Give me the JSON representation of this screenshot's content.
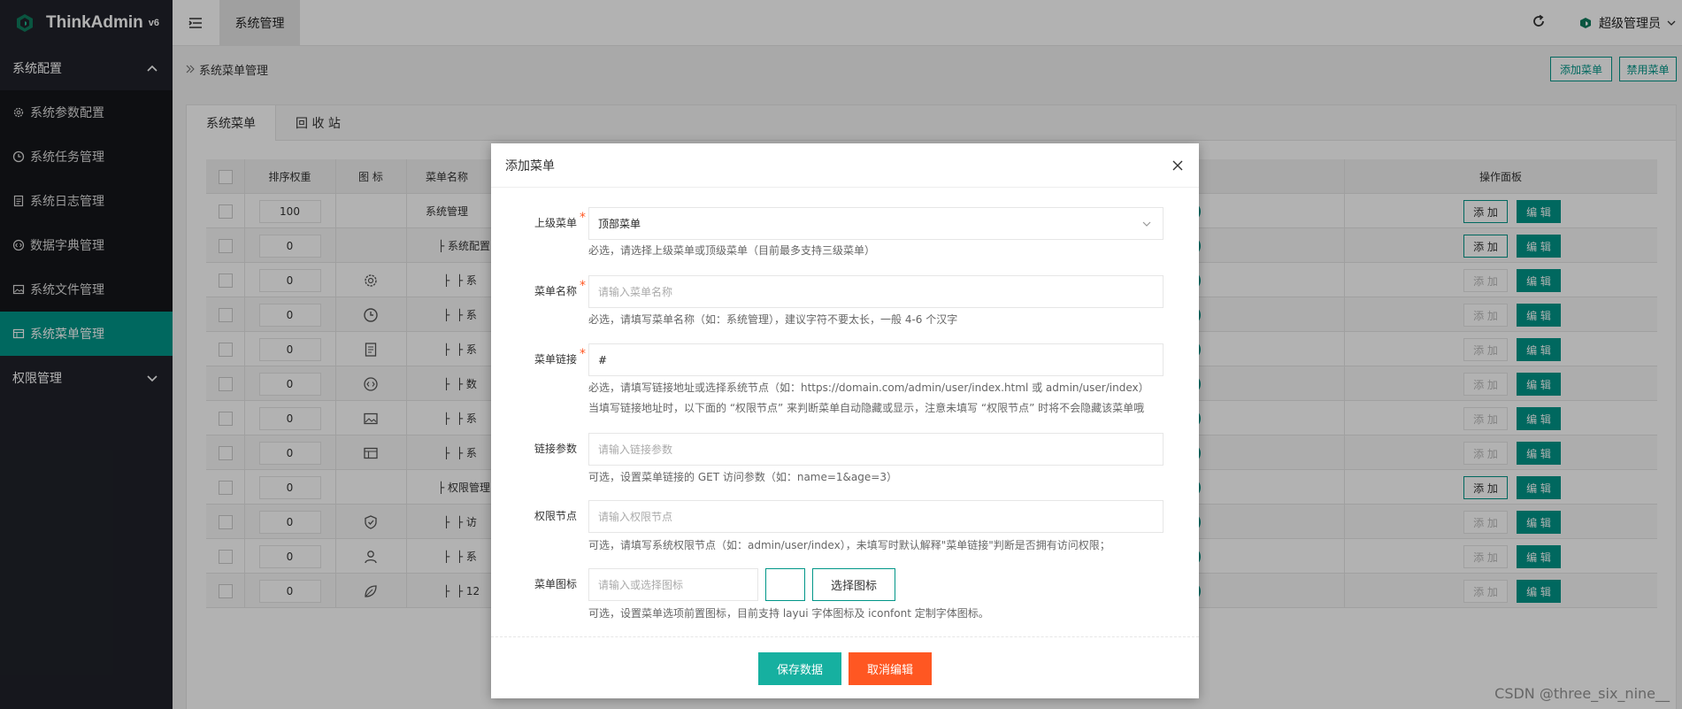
{
  "brand": {
    "name": "ThinkAdmin",
    "version": "v6"
  },
  "sidebar": {
    "group1": "系统配置",
    "items": [
      {
        "label": "系统参数配置",
        "icon": "gear-icon"
      },
      {
        "label": "系统任务管理",
        "icon": "clock-icon"
      },
      {
        "label": "系统日志管理",
        "icon": "log-icon"
      },
      {
        "label": "数据字典管理",
        "icon": "code-icon"
      },
      {
        "label": "系统文件管理",
        "icon": "image-icon"
      },
      {
        "label": "系统菜单管理",
        "icon": "menu-icon"
      }
    ],
    "group2": "权限管理"
  },
  "header": {
    "tab": "系统管理",
    "user": "超级管理员"
  },
  "breadcrumb": "系统菜单管理",
  "toolbar": {
    "add": "添加菜单",
    "disable": "禁用菜单"
  },
  "tabs": [
    "系统菜单",
    "回 收 站"
  ],
  "table": {
    "headers": {
      "weight": "排序权重",
      "icon": "图 标",
      "name": "菜单名称",
      "panel": "操作面板"
    },
    "rows": [
      {
        "weight": "100",
        "name": "系统管理",
        "icon": "",
        "add": "添 加",
        "edit": "编 辑"
      },
      {
        "weight": "0",
        "name": "├ 系统配置",
        "icon": "",
        "add": "添 加",
        "edit": "编 辑"
      },
      {
        "weight": "0",
        "name": "├  ├ 系",
        "icon": "gear-icon",
        "add": "添 加",
        "edit": "编 辑"
      },
      {
        "weight": "0",
        "name": "├  ├ 系",
        "icon": "clock-icon",
        "add": "添 加",
        "edit": "编 辑"
      },
      {
        "weight": "0",
        "name": "├  ├ 系",
        "icon": "log-icon",
        "add": "添 加",
        "edit": "编 辑"
      },
      {
        "weight": "0",
        "name": "├  ├ 数",
        "icon": "code-icon",
        "add": "添 加",
        "edit": "编 辑"
      },
      {
        "weight": "0",
        "name": "├  ├ 系",
        "icon": "image-icon",
        "add": "添 加",
        "edit": "编 辑"
      },
      {
        "weight": "0",
        "name": "├  ├ 系",
        "icon": "menu-icon",
        "add": "添 加",
        "edit": "编 辑"
      },
      {
        "weight": "0",
        "name": "├ 权限管理",
        "icon": "",
        "add": "添 加",
        "edit": "编 辑"
      },
      {
        "weight": "0",
        "name": "├  ├ 访",
        "icon": "shield-icon",
        "add": "添 加",
        "edit": "编 辑"
      },
      {
        "weight": "0",
        "name": "├  ├ 系",
        "icon": "user-icon",
        "add": "添 加",
        "edit": "编 辑"
      },
      {
        "weight": "0",
        "name": "├  ├ 12",
        "icon": "leaf-icon",
        "add": "添 加",
        "edit": "编 辑"
      }
    ]
  },
  "modal": {
    "title": "添加菜单",
    "parent": {
      "label": "上级菜单",
      "value": "顶部菜单",
      "hint": "必选，请选择上级菜单或顶级菜单（目前最多支持三级菜单）"
    },
    "name": {
      "label": "菜单名称",
      "placeholder": "请输入菜单名称",
      "hint": "必选，请填写菜单名称（如：系统管理），建议字符不要太长，一般 4-6 个汉字"
    },
    "link": {
      "label": "菜单链接",
      "value": "#",
      "hint1": "必选，请填写链接地址或选择系统节点（如：https://domain.com/admin/user/index.html 或 admin/user/index）",
      "hint2": "当填写链接地址时，以下面的 “权限节点” 来判断菜单自动隐藏或显示，注意未填写 “权限节点” 时将不会隐藏该菜单哦"
    },
    "params": {
      "label": "链接参数",
      "placeholder": "请输入链接参数",
      "hint": "可选，设置菜单链接的 GET 访问参数（如：name=1&age=3）"
    },
    "node": {
      "label": "权限节点",
      "placeholder": "请输入权限节点",
      "hint": "可选，请填写系统权限节点（如：admin/user/index），未填写时默认解释\"菜单链接\"判断是否拥有访问权限；"
    },
    "icon": {
      "label": "菜单图标",
      "placeholder": "请输入或选择图标",
      "button": "选择图标",
      "hint": "可选，设置菜单选项前置图标，目前支持 layui 字体图标及 iconfont 定制字体图标。"
    },
    "save": "保存数据",
    "cancel": "取消编辑"
  },
  "watermark": "CSDN @three_six_nine__",
  "colors": {
    "primary": "#009688",
    "danger": "#ff5722",
    "sidebar": "#20222a"
  }
}
